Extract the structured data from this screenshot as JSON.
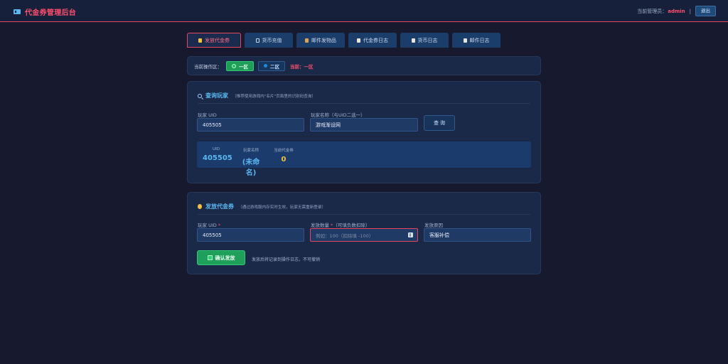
{
  "header": {
    "title": "代金券管理后台",
    "admin_label": "当前管理员：",
    "admin_name": "admin",
    "separator": "|",
    "logout": "退出"
  },
  "tabs": [
    "发放代金券",
    "货币充值",
    "邮件发物品",
    "代金券日志",
    "货币日志",
    "邮件日志"
  ],
  "zone": {
    "label": "当前操作区：",
    "zone1": "一区",
    "zone2": "二区",
    "current": "当前：一区"
  },
  "query": {
    "title": "查询玩家",
    "note": "（推荐使用游戏内\"名片\"页面里的识别码查询）",
    "uid_label": "玩家 UID",
    "uid_value": "405505",
    "name_label": "玩家名称（与UID二选一）",
    "name_value": "游戏渐设网",
    "button": "查 询",
    "result": {
      "uid_label": "UID",
      "uid_value": "405505",
      "name_label": "玩家名称",
      "name_value": "(未命名)",
      "coupon_label": "当前代金券",
      "coupon_value": "0"
    }
  },
  "issue": {
    "title": "发放代金券",
    "note": "（通过游戏服内存实时生效，玩家无需重新登录）",
    "uid_label": "玩家 UID",
    "required": "*",
    "uid_value": "405505",
    "amount_label": "发放数量",
    "amount_hint": "（可填负数扣除）",
    "amount_placeholder": "例如：100（扣除填 -100）",
    "reason_label": "发放原因",
    "reason_value": "客服补偿",
    "confirm": "确认发放",
    "confirm_note": "发放后将记录到操作日志，不可撤销"
  }
}
